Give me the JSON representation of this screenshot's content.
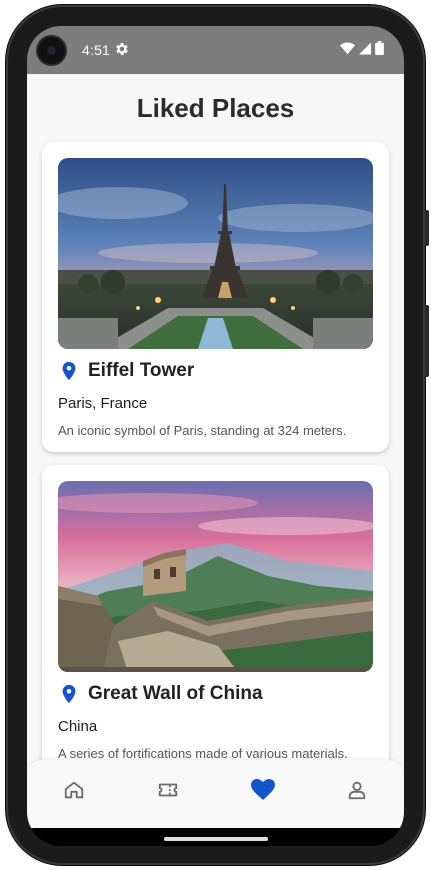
{
  "status_bar": {
    "time": "4:51",
    "icons": [
      "settings-gear-icon",
      "wifi-icon",
      "signal-icon",
      "battery-icon"
    ]
  },
  "page": {
    "title": "Liked Places"
  },
  "places": [
    {
      "name": "Eiffel Tower",
      "location": "Paris, France",
      "description": "An iconic symbol of Paris, standing at 324 meters.",
      "icon": "location-pin-icon"
    },
    {
      "name": "Great Wall of China",
      "location": "China",
      "description": "A series of fortifications made of various materials.",
      "icon": "location-pin-icon"
    }
  ],
  "bottom_nav": {
    "items": [
      {
        "icon": "home-icon",
        "active": false
      },
      {
        "icon": "ticket-icon",
        "active": false
      },
      {
        "icon": "heart-icon",
        "active": true
      },
      {
        "icon": "profile-icon",
        "active": false
      }
    ]
  },
  "colors": {
    "accent": "#1255cc",
    "inactive_icon": "#6b6b6b",
    "status_bar": "#7d7d7d",
    "background": "#f7f7f8"
  }
}
